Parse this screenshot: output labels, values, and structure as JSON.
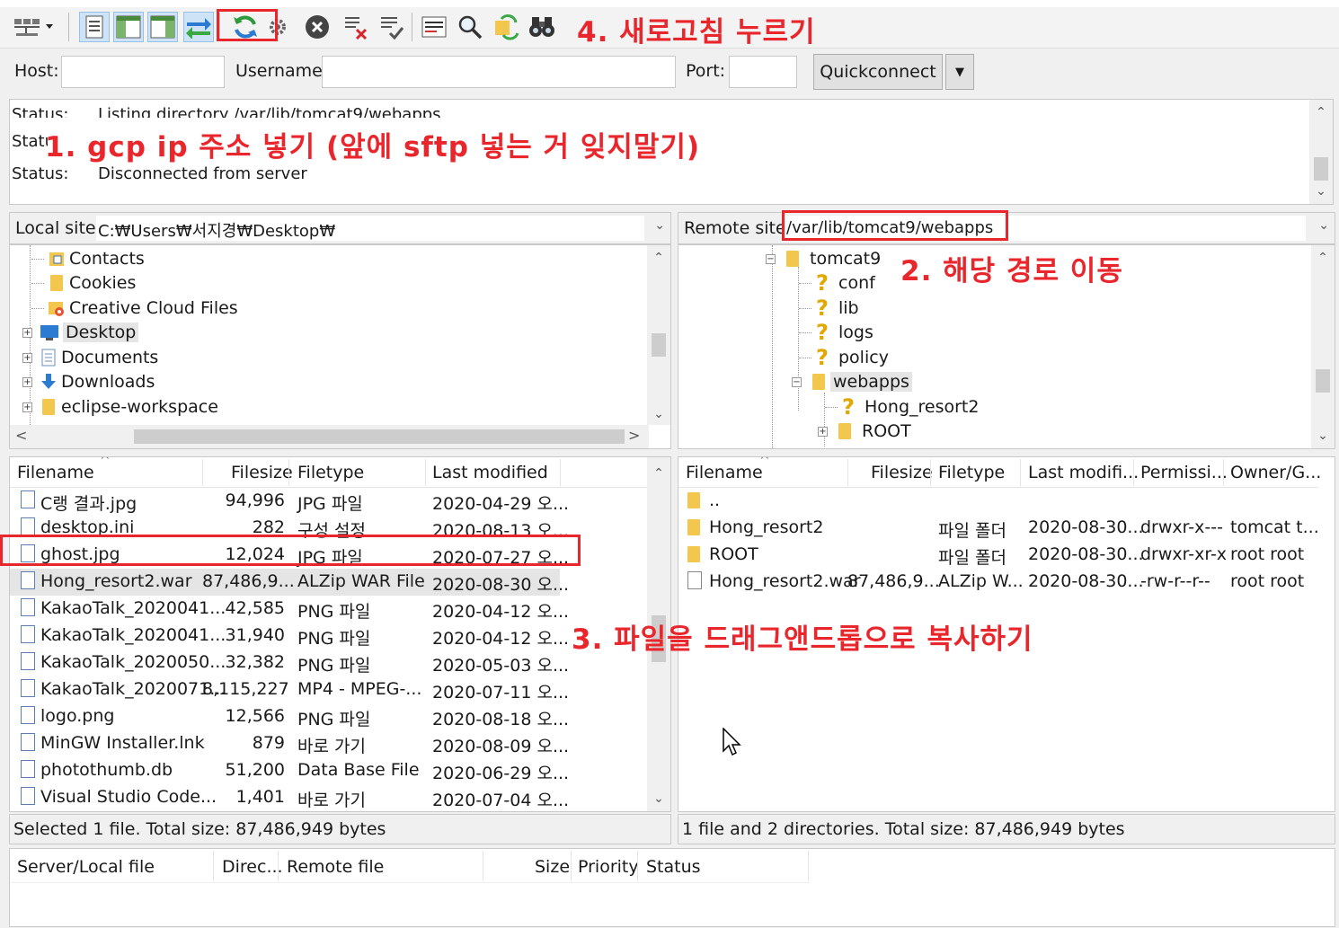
{
  "toolbar": {
    "icons": [
      "site-manager-icon",
      "toggle-log-icon",
      "toggle-local-tree-icon",
      "toggle-remote-tree-icon",
      "transfer-queue-icon",
      "refresh-icon",
      "process-queue-icon",
      "cancel-icon",
      "disconnect-icon",
      "reconnect-icon",
      "filter-icon",
      "search-icon",
      "sync-browse-icon",
      "find-icon"
    ]
  },
  "quickconnect": {
    "host_label": "Host:",
    "host_value": "",
    "username_label": "Username:",
    "username_value": "",
    "port_label": "Port:",
    "port_value": "",
    "button_label": "Quickconnect",
    "dropdown_glyph": "▼"
  },
  "log": {
    "lines": [
      {
        "label": "Status:",
        "text": "Listing directory /var/lib/tomcat9/webapps"
      },
      {
        "label": "Status:",
        "text": ""
      },
      {
        "label": "Status:",
        "text": "Disconnected from server"
      }
    ]
  },
  "local": {
    "site_label": "Local site:",
    "site_path": "C:₩Users₩서지경₩Desktop₩",
    "tree": [
      "Contacts",
      "Cookies",
      "Creative Cloud Files",
      "Desktop",
      "Documents",
      "Downloads",
      "eclipse-workspace"
    ],
    "columns": [
      "Filename",
      "Filesize",
      "Filetype",
      "Last modified"
    ],
    "files": [
      {
        "name": "C랭 결과.jpg",
        "size": "94,996",
        "type": "JPG 파일",
        "modified": "2020-04-29 오..."
      },
      {
        "name": "desktop.ini",
        "size": "282",
        "type": "구성 설정",
        "modified": "2020-08-13 오..."
      },
      {
        "name": "ghost.jpg",
        "size": "12,024",
        "type": "JPG 파일",
        "modified": "2020-07-27 오..."
      },
      {
        "name": "Hong_resort2.war",
        "size": "87,486,9...",
        "type": "ALZip WAR File",
        "modified": "2020-08-30 오..."
      },
      {
        "name": "KakaoTalk_2020041...",
        "size": "42,585",
        "type": "PNG 파일",
        "modified": "2020-04-12 오..."
      },
      {
        "name": "KakaoTalk_2020041...",
        "size": "31,940",
        "type": "PNG 파일",
        "modified": "2020-04-12 오..."
      },
      {
        "name": "KakaoTalk_2020050...",
        "size": "32,382",
        "type": "PNG 파일",
        "modified": "2020-05-03 오..."
      },
      {
        "name": "KakaoTalk_2020071...",
        "size": "8,115,227",
        "type": "MP4 - MPEG-...",
        "modified": "2020-07-11 오..."
      },
      {
        "name": "logo.png",
        "size": "12,566",
        "type": "PNG 파일",
        "modified": "2020-08-18 오..."
      },
      {
        "name": "MinGW Installer.lnk",
        "size": "879",
        "type": "바로 가기",
        "modified": "2020-08-09 오..."
      },
      {
        "name": "photothumb.db",
        "size": "51,200",
        "type": "Data Base File",
        "modified": "2020-06-29 오..."
      },
      {
        "name": "Visual Studio Code...",
        "size": "1,401",
        "type": "바로 가기",
        "modified": "2020-07-04 오..."
      }
    ],
    "status": "Selected 1 file. Total size: 87,486,949 bytes"
  },
  "remote": {
    "site_label": "Remote site:",
    "site_path": "/var/lib/tomcat9/webapps",
    "tree": [
      "tomcat9",
      "conf",
      "lib",
      "logs",
      "policy",
      "webapps",
      "Hong_resort2",
      "ROOT"
    ],
    "columns": [
      "Filename",
      "Filesize",
      "Filetype",
      "Last modifi...",
      "Permissi...",
      "Owner/G..."
    ],
    "files": [
      {
        "name": "..",
        "size": "",
        "type": "",
        "modified": "",
        "perm": "",
        "owner": ""
      },
      {
        "name": "Hong_resort2",
        "size": "",
        "type": "파일 폴더",
        "modified": "2020-08-30...",
        "perm": "drwxr-x---",
        "owner": "tomcat t..."
      },
      {
        "name": "ROOT",
        "size": "",
        "type": "파일 폴더",
        "modified": "2020-08-30...",
        "perm": "drwxr-xr-x",
        "owner": "root root"
      },
      {
        "name": "Hong_resort2.war",
        "size": "87,486,9...",
        "type": "ALZip W...",
        "modified": "2020-08-30...",
        "perm": "-rw-r--r--",
        "owner": "root root"
      }
    ],
    "status": "1 file and 2 directories. Total size: 87,486,949 bytes"
  },
  "queue": {
    "columns": [
      "Server/Local file",
      "Direc...",
      "Remote file",
      "Size",
      "Priority",
      "Status"
    ]
  },
  "annotations": {
    "step1": "1. gcp ip 주소 넣기 (앞에 sftp 넣는 거 잊지말기)",
    "step2": "2. 해당 경로 이동",
    "step3": "3. 파일을 드래그앤드롭으로 복사하기",
    "step4": "4. 새로고침 누르기",
    "color": "#e8262c"
  },
  "colors": {
    "folder": "#f3c64e",
    "selection": "#e5e5e5",
    "pressed": "#cfe3f6"
  }
}
